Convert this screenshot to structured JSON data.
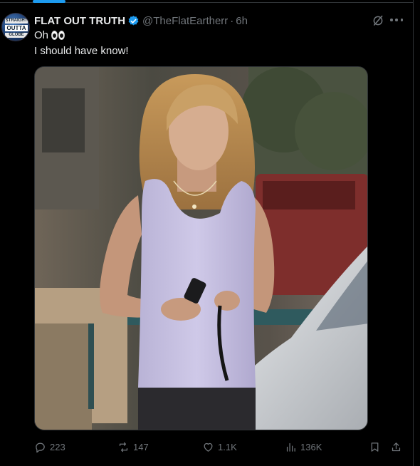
{
  "tweet": {
    "author_name": "FLAT OUT TRUTH",
    "handle": "@TheFlatEartherr",
    "separator": "·",
    "time": "6h",
    "text_line1": "Oh",
    "text_line2": "I should have know!",
    "emoji": "eyes"
  },
  "avatar": {
    "text_top": "STRAIGHT",
    "text_mid": "OUTTA",
    "text_bot": "GLOBE"
  },
  "actions": {
    "replies": "223",
    "reposts": "147",
    "likes": "1.1K",
    "views": "136K"
  },
  "icons": {
    "verified": "verified-badge-icon",
    "grok": "grok-icon",
    "more": "more-icon",
    "reply": "reply-icon",
    "repost": "repost-icon",
    "like": "heart-icon",
    "views": "views-icon",
    "bookmark": "bookmark-icon",
    "share": "share-icon"
  },
  "colors": {
    "background": "#000000",
    "text": "#e7e9ea",
    "muted": "#71767b",
    "accent": "#1d9bf0"
  }
}
